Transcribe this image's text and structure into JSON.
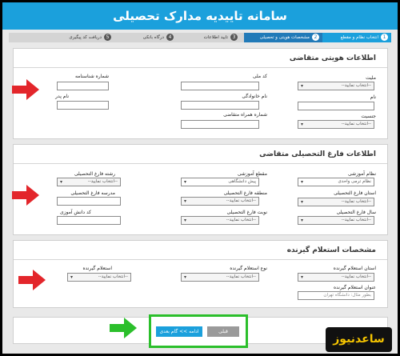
{
  "app": {
    "title": "سامانه تاییدیه مدارک تحصیلی"
  },
  "steps": [
    {
      "num": "1",
      "label": "انتخاب نظام و مقطع"
    },
    {
      "num": "2",
      "label": "مشخصات هویتی و تحصیلی"
    },
    {
      "num": "3",
      "label": "تایید اطلاعات"
    },
    {
      "num": "4",
      "label": "درگاه بانکی"
    },
    {
      "num": "5",
      "label": "دریافت کد پیگیری"
    }
  ],
  "identity": {
    "title": "اطلاعات هویتی متقاضی",
    "nationality_label": "ملیت",
    "nationality_value": "--انتخاب نمایید--",
    "national_code_label": "کد ملی",
    "id_number_label": "شماره شناسنامه",
    "first_name_label": "نام",
    "last_name_label": "نام خانوادگی",
    "father_name_label": "نام پدر",
    "gender_label": "جنسیت",
    "gender_value": "--انتخاب نمایید--",
    "mobile_label": "شماره همراه متقاضی"
  },
  "graduation": {
    "title": "اطلاعات فارغ التحصیلی متقاضی",
    "system_label": "نظام آموزشی",
    "system_value": "نظام ترمی واحدی",
    "grade_label": "مقطع آموزشی",
    "grade_value": "پیش دانشگاهی",
    "field_label": "رشته فارغ التحصیلی",
    "field_value": "--انتخاب نمایید--",
    "province_label": "استان فارغ التحصیلی",
    "province_value": "--انتخاب نمایید--",
    "region_label": "منطقه فارغ التحصیلی",
    "region_value": "--انتخاب نمایید--",
    "school_label": "مدرسه فارغ التحصیلی",
    "year_label": "سال فارغ التحصیلی",
    "year_value": "--انتخاب نمایید--",
    "term_label": "نوبت فارغ التحصیلی",
    "term_value": "--انتخاب نمایید--",
    "student_code_label": "کد دانش آموزی"
  },
  "employer": {
    "title": "مشخصات استعلام گیرنده",
    "province_label": "استان استعلام گیرنده",
    "province_value": "--انتخاب نمایید--",
    "type_label": "نوع استعلام گیرنده",
    "type_value": "--انتخاب نمایید--",
    "name_label": "استعلام گیرنده",
    "name_value": "--انتخاب نمایید--",
    "title_label": "عنوان استعلام گیرنده",
    "title_placeholder": "بطور مثال: دانشگاه تهران"
  },
  "actions": {
    "next": "ادامه >> گام بعدی",
    "prev": "قبلی"
  },
  "logo": {
    "text": "ساعدنیوز"
  },
  "colors": {
    "accent": "#1ba0dc",
    "arrow": "#e3262b",
    "highlight": "#2bbf2b"
  }
}
